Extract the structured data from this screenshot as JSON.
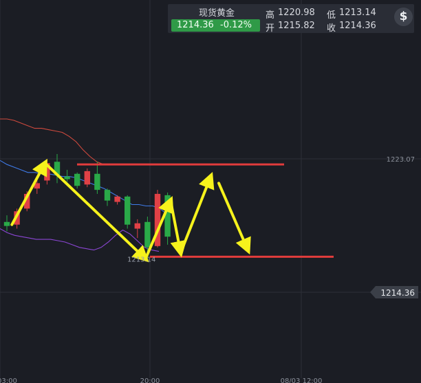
{
  "header": {
    "instrument": "现货黄金",
    "last_price": "1214.36",
    "change_pct": "-0.12%",
    "high_label": "高",
    "high_value": "1220.98",
    "low_label": "低",
    "low_value": "1213.14",
    "open_label": "开",
    "open_value": "1215.82",
    "close_label": "收",
    "close_value": "1214.36",
    "dollar_icon": "dollar-icon",
    "dollar_symbol": "$"
  },
  "colors": {
    "background": "#1b1d24",
    "up_candle": "#e04146",
    "down_candle": "#2aa948",
    "ma_line": "#3f7be8",
    "upper_band": "#cf4a3e",
    "lower_band": "#8b46d4",
    "annotation_arrow": "#f6f21c",
    "annotation_line": "#e23c3c"
  },
  "chart_data": {
    "type": "candlestick",
    "title": "",
    "ylim": [
      1206.0,
      1229.0
    ],
    "x_ticks": [
      "03:00",
      "20:00",
      "08/03 12:00"
    ],
    "y_ticks": [
      1223.07
    ],
    "last_price_tag": "1214.36",
    "low_marker": "1213.14",
    "candles": [
      {
        "o": 1215.9,
        "h": 1216.4,
        "l": 1215.2,
        "c": 1215.6
      },
      {
        "o": 1215.7,
        "h": 1216.9,
        "l": 1215.4,
        "c": 1216.7
      },
      {
        "o": 1216.9,
        "h": 1218.2,
        "l": 1216.7,
        "c": 1218.0
      },
      {
        "o": 1218.4,
        "h": 1219.1,
        "l": 1218.0,
        "c": 1218.8
      },
      {
        "o": 1219.0,
        "h": 1220.6,
        "l": 1218.7,
        "c": 1220.3
      },
      {
        "o": 1220.4,
        "h": 1220.98,
        "l": 1218.8,
        "c": 1219.4
      },
      {
        "o": 1219.3,
        "h": 1219.8,
        "l": 1218.9,
        "c": 1219.1
      },
      {
        "o": 1219.5,
        "h": 1219.6,
        "l": 1218.4,
        "c": 1218.6
      },
      {
        "o": 1218.7,
        "h": 1219.9,
        "l": 1218.5,
        "c": 1219.7
      },
      {
        "o": 1219.5,
        "h": 1220.4,
        "l": 1218.0,
        "c": 1218.3
      },
      {
        "o": 1218.3,
        "h": 1218.4,
        "l": 1217.1,
        "c": 1217.5
      },
      {
        "o": 1217.4,
        "h": 1217.9,
        "l": 1217.2,
        "c": 1217.8
      },
      {
        "o": 1217.8,
        "h": 1217.9,
        "l": 1215.4,
        "c": 1215.7
      },
      {
        "o": 1215.4,
        "h": 1216.1,
        "l": 1214.7,
        "c": 1215.8
      },
      {
        "o": 1215.9,
        "h": 1216.3,
        "l": 1213.14,
        "c": 1214.0
      },
      {
        "o": 1214.1,
        "h": 1218.3,
        "l": 1214.0,
        "c": 1218.0
      },
      {
        "o": 1217.9,
        "h": 1218.1,
        "l": 1214.2,
        "c": 1214.8
      },
      {
        "o": 1214.4,
        "h": 1214.8,
        "l": 1213.9,
        "c": 1214.36
      }
    ],
    "series": [
      {
        "values": [
          1223.6,
          1223.6,
          1223.5,
          1223.3,
          1223.1,
          1222.9,
          1222.9,
          1222.8,
          1222.7,
          1222.6,
          1222.3,
          1221.9,
          1221.3,
          1220.8,
          1220.4,
          1220.2,
          1220.2,
          1220.2,
          1220.2,
          1220.2,
          1220.2,
          1220.2,
          1220.2
        ]
      },
      {
        "values": [
          1220.5,
          1220.2,
          1220.0,
          1219.8,
          1219.6,
          1219.6,
          1219.5,
          1219.5,
          1219.4,
          1219.3,
          1219.3,
          1219.2,
          1219.0,
          1218.8,
          1218.6,
          1218.4,
          1218.1,
          1217.8,
          1217.5,
          1217.2,
          1217.2,
          1217.1,
          1217.1,
          1216.9,
          1216.5
        ]
      },
      {
        "values": [
          1215.4,
          1215.1,
          1214.9,
          1214.8,
          1214.7,
          1214.6,
          1214.6,
          1214.6,
          1214.5,
          1214.4,
          1214.2,
          1214.0,
          1213.9,
          1213.8,
          1214.0,
          1214.4,
          1214.9,
          1215.3,
          1215.0,
          1214.5,
          1214.0,
          1213.8,
          1213.7
        ]
      }
    ],
    "horizontal_lines": [
      1220.2,
      1213.3
    ],
    "annotations": [
      {
        "from": [
          0.5,
          1215.7
        ],
        "to": [
          3.8,
          1220.3
        ]
      },
      {
        "from": [
          3.8,
          1220.3
        ],
        "to": [
          13.8,
          1213.14
        ]
      },
      {
        "from": [
          13.8,
          1213.14
        ],
        "to": [
          16.3,
          1217.5
        ]
      },
      {
        "from": [
          16.3,
          1217.5
        ],
        "to": [
          17.3,
          1213.6
        ]
      },
      {
        "from": [
          17.3,
          1213.6
        ],
        "to": [
          20.3,
          1219.3
        ]
      },
      {
        "from": [
          21.1,
          1218.8
        ],
        "to": [
          24.0,
          1213.8
        ]
      }
    ]
  }
}
